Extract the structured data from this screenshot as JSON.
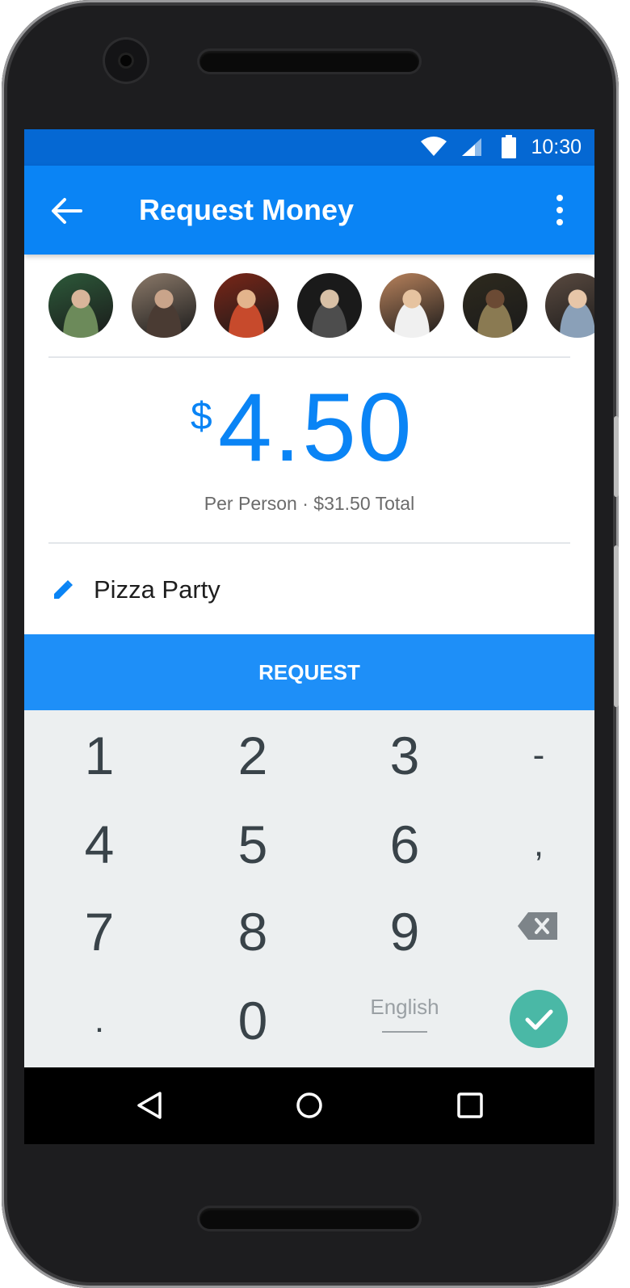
{
  "status_bar": {
    "time": "10:30",
    "icons": [
      "wifi-icon",
      "signal-icon",
      "battery-icon"
    ]
  },
  "app_bar": {
    "title": "Request Money",
    "back_icon": "arrow-left-icon",
    "menu_icon": "more-vertical-icon"
  },
  "recipients": [
    {
      "name": "avatar-1",
      "colors": [
        "#2d5a3a",
        "#d9b59a",
        "#6c8a5a"
      ]
    },
    {
      "name": "avatar-2",
      "colors": [
        "#8c7a6a",
        "#c9a48a",
        "#4a3b33"
      ]
    },
    {
      "name": "avatar-3",
      "colors": [
        "#7a2618",
        "#e3b48c",
        "#c74a2c"
      ]
    },
    {
      "name": "avatar-4",
      "colors": [
        "#1a1a1a",
        "#d8c0a6",
        "#4d4d4d"
      ]
    },
    {
      "name": "avatar-5",
      "colors": [
        "#b8825c",
        "#e6c3a0",
        "#f0f0f0"
      ]
    },
    {
      "name": "avatar-6",
      "colors": [
        "#2e2a1e",
        "#6b4a34",
        "#8a7a52"
      ]
    },
    {
      "name": "avatar-7",
      "colors": [
        "#5a4a40",
        "#e7c6a8",
        "#8aa0b8"
      ]
    }
  ],
  "amount": {
    "currency": "$",
    "value": "4.50",
    "subtitle": "Per Person · $31.50 Total"
  },
  "memo": {
    "text": "Pizza Party",
    "icon": "pencil-icon"
  },
  "request_button": {
    "label": "REQUEST"
  },
  "keypad": {
    "keys": [
      "1",
      "2",
      "3",
      "-",
      "4",
      "5",
      "6",
      ",",
      "7",
      "8",
      "9",
      ".",
      "0"
    ],
    "language": "English",
    "backspace_icon": "backspace-icon",
    "confirm_icon": "check-icon"
  },
  "nav_bar": {
    "icons": [
      "back-triangle-icon",
      "home-circle-icon",
      "recents-square-icon"
    ]
  },
  "colors": {
    "status_bar": "#0568d3",
    "app_bar": "#0a84f5",
    "accent": "#0a84f5",
    "request_button": "#1e8ff8",
    "keypad_bg": "#eceff0",
    "confirm": "#4ab8a6"
  }
}
